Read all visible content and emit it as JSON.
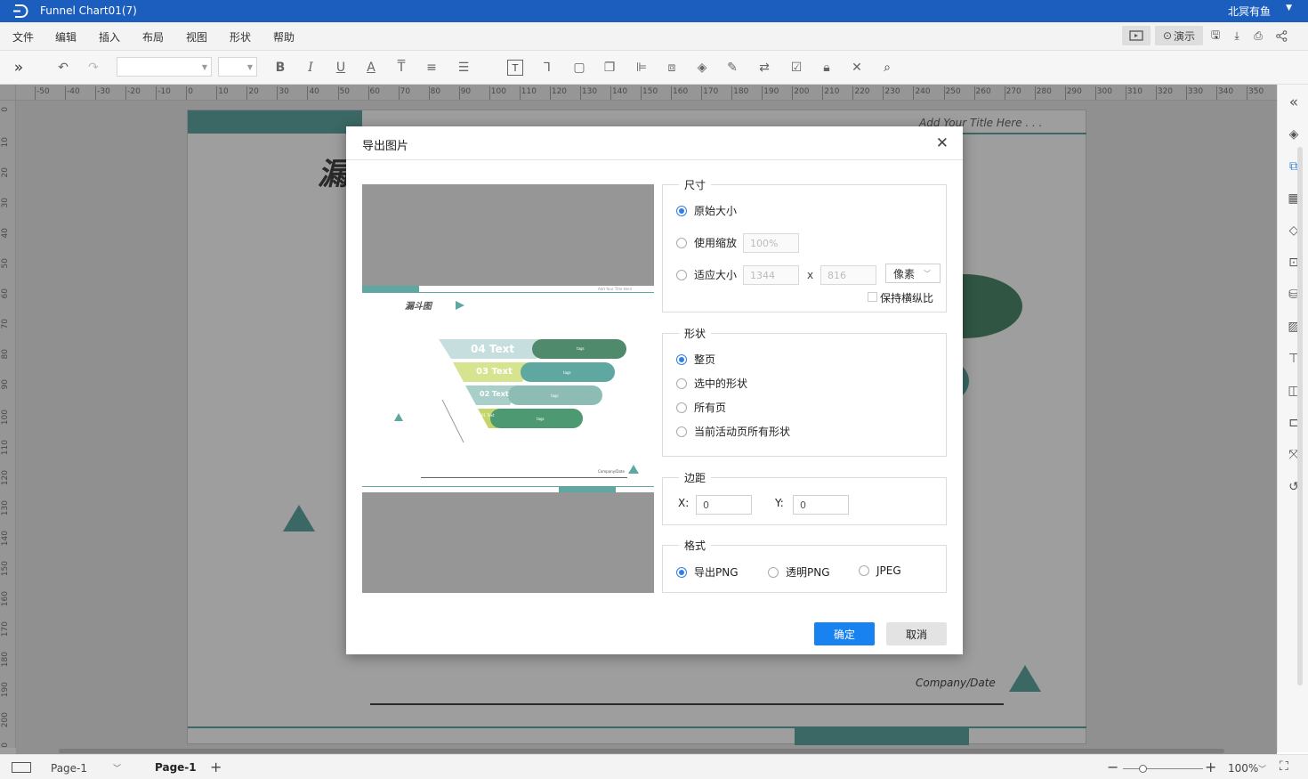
{
  "window": {
    "title": "Funnel Chart01(7)",
    "user": "北冥有鱼",
    "user_menu_icon": "chevron-down-icon"
  },
  "menu": [
    "文件",
    "编辑",
    "插入",
    "布局",
    "视图",
    "形状",
    "帮助"
  ],
  "topright": {
    "present_label": "演示"
  },
  "toolbar": {
    "font_family": "",
    "font_size": ""
  },
  "ruler": {
    "h_ticks": [
      "0",
      "-50",
      "-40",
      "-30",
      "-20",
      "-10",
      "0",
      "10",
      "20",
      "30",
      "40",
      "50",
      "60",
      "70",
      "80",
      "90",
      "100",
      "110",
      "120",
      "130",
      "140",
      "150",
      "160",
      "170",
      "180",
      "190",
      "200",
      "210",
      "220",
      "230",
      "240",
      "250",
      "260",
      "270",
      "280",
      "290",
      "300",
      "310",
      "320",
      "330",
      "340",
      "350"
    ],
    "v_ticks": [
      "0",
      "10",
      "20",
      "30",
      "40",
      "50",
      "60",
      "70",
      "80",
      "90",
      "100",
      "110",
      "120",
      "130",
      "140",
      "150",
      "160",
      "170",
      "180",
      "190",
      "200",
      "210"
    ]
  },
  "slide": {
    "header_placeholder": "Add Your Title Here . . .",
    "title_fragment": "漏",
    "footer_text": "Company/Date"
  },
  "preview": {
    "title": "漏斗图",
    "header": "Add Your Title Here",
    "levels": [
      "04 Text",
      "03 Text",
      "02 Text",
      "01 Text"
    ],
    "tag": "tags",
    "footer": "Company/Date"
  },
  "dialog": {
    "title": "导出图片",
    "size": {
      "legend": "尺寸",
      "original": "原始大小",
      "scale": "使用缩放",
      "scale_value": "100%",
      "fit": "适应大小",
      "width": "1344",
      "times": "x",
      "height": "816",
      "unit": "像素",
      "keep_ratio": "保持横纵比"
    },
    "shape": {
      "legend": "形状",
      "options": [
        "整页",
        "选中的形状",
        "所有页",
        "当前活动页所有形状"
      ]
    },
    "margin": {
      "legend": "边距",
      "x_label": "X:",
      "x_value": "0",
      "y_label": "Y:",
      "y_value": "0"
    },
    "format": {
      "legend": "格式",
      "options": [
        "导出PNG",
        "透明PNG",
        "JPEG"
      ]
    },
    "ok": "确定",
    "cancel": "取消"
  },
  "statusbar": {
    "page_select": "Page-1",
    "page_tab": "Page-1",
    "add": "+",
    "zoom": "100%"
  },
  "colors": {
    "brand_blue": "#1c5ebd",
    "teal": "#5fa8a2",
    "green": "#4f8a6d",
    "primary_button": "#1882f0"
  }
}
